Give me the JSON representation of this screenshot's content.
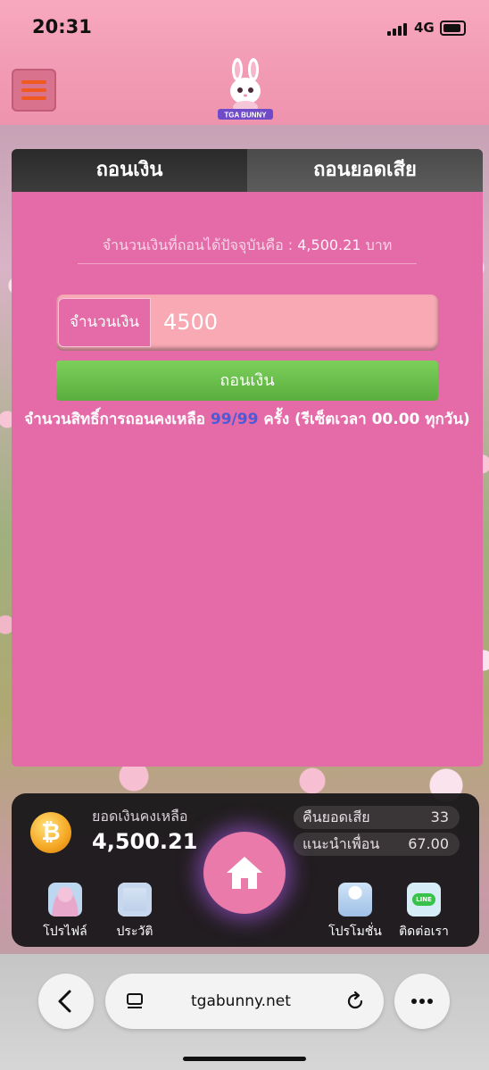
{
  "status_bar": {
    "time": "20:31",
    "network": "4G"
  },
  "header": {
    "logo_text": "TGA BUNNY"
  },
  "tabs": [
    {
      "label": "ถอนเงิน",
      "active": true
    },
    {
      "label": "ถอนยอดเสีย",
      "active": false
    }
  ],
  "withdraw": {
    "balance_prefix": "จำนวนเงินที่ถอนได้ปัจจุบันคือ :",
    "balance_amount": "4,500.21",
    "balance_unit": "บาท",
    "amount_label": "จำนวนเงิน",
    "amount_value": "4500",
    "submit_label": "ถอนเงิน",
    "rights_prefix": "จำนวนสิทธิ์การถอนคงเหลือ",
    "rights_count": "99/99",
    "rights_suffix": "ครั้ง (รีเซ็ตเวลา 00.00 ทุกวัน)"
  },
  "wallet": {
    "title": "ยอดเงินคงเหลือ",
    "amount": "4,500.21",
    "coin_symbol": "₿",
    "cashback_label": "คืนยอดเสีย",
    "cashback_value": "33",
    "referral_label": "แนะนำเพื่อน",
    "referral_value": "67.00"
  },
  "bottom_nav": [
    {
      "label": "โปรไฟล์",
      "icon": "profile-icon"
    },
    {
      "label": "ประวัติ",
      "icon": "history-icon"
    },
    {
      "label": "โปรโมชั่น",
      "icon": "promotion-icon"
    },
    {
      "label": "ติดต่อเรา",
      "icon": "line-contact-icon",
      "badge": "LINE"
    }
  ],
  "browser": {
    "url": "tgabunny.net"
  },
  "colors": {
    "panel": "#e46ba8",
    "submit_button": "#6cc04a",
    "rights_count": "#4a5bd9",
    "home_button": "#e97aa9"
  }
}
